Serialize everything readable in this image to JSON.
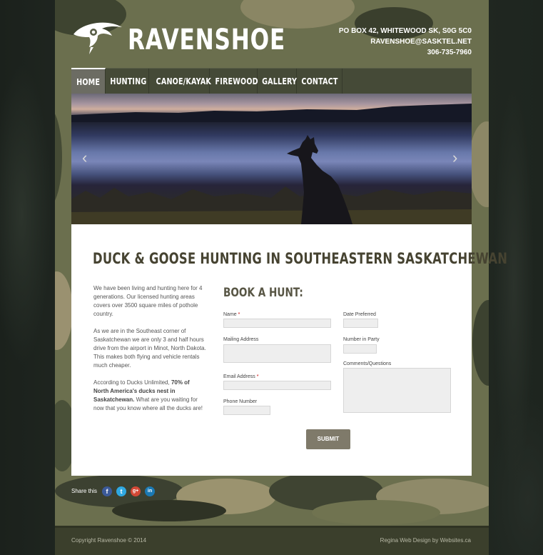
{
  "brand": {
    "name": "RAVENSHOE"
  },
  "contact": {
    "address": "PO BOX 42, WHITEWOOD SK, S0G 5C0",
    "email": "RAVENSHOE@SASKTEL.NET",
    "phone": "306-735-7960"
  },
  "nav": {
    "items": [
      {
        "label": "HOME",
        "active": true
      },
      {
        "label": "HUNTING"
      },
      {
        "label": "CANOE/KAYAK"
      },
      {
        "label": "FIREWOOD"
      },
      {
        "label": "GALLERY"
      },
      {
        "label": "CONTACT"
      }
    ]
  },
  "hero": {
    "prev_icon": "chevron-left-icon",
    "next_icon": "chevron-right-icon",
    "prev_glyph": "‹",
    "next_glyph": "›"
  },
  "main": {
    "title": "DUCK & GOOSE HUNTING IN SOUTHEASTERN SASKATCHEWAN",
    "intro": {
      "p1": "We have been living and hunting here for 4 generations. Our licensed hunting areas covers over 3500 square miles of pothole country.",
      "p2": "As we are in the Southeast corner of Saskatchewan we are only 3 and half hours drive from the airport in Minot, North Dakota. This makes both flying and vehicle rentals much cheaper.",
      "p3_start": "According to Ducks Unlimited, ",
      "p3_bold": "70% of North America's ducks nest in Saskatchewan.",
      "p3_end": " What are you waiting for now that you know where all the ducks are!"
    }
  },
  "form": {
    "title": "BOOK A HUNT:",
    "name_label": "Name",
    "mailing_label": "Mailing Address",
    "email_label": "Email Address",
    "phone_label": "Phone Number",
    "date_label": "Date Preferred",
    "party_label": "Number in Party",
    "comments_label": "Comments/Questions",
    "required_mark": "*",
    "submit_label": "SUBMIT"
  },
  "share": {
    "label": "Share this",
    "networks": [
      {
        "name": "facebook",
        "glyph": "f",
        "color": "#3b5998"
      },
      {
        "name": "twitter",
        "glyph": "t",
        "color": "#2fa8e1"
      },
      {
        "name": "google-plus",
        "glyph": "g+",
        "color": "#d34836"
      },
      {
        "name": "linkedin",
        "glyph": "in",
        "color": "#1b79b3"
      }
    ]
  },
  "footer": {
    "copyright": "Copyright Ravenshoe © 2014",
    "credit": "Regina Web Design by Websites.ca"
  }
}
